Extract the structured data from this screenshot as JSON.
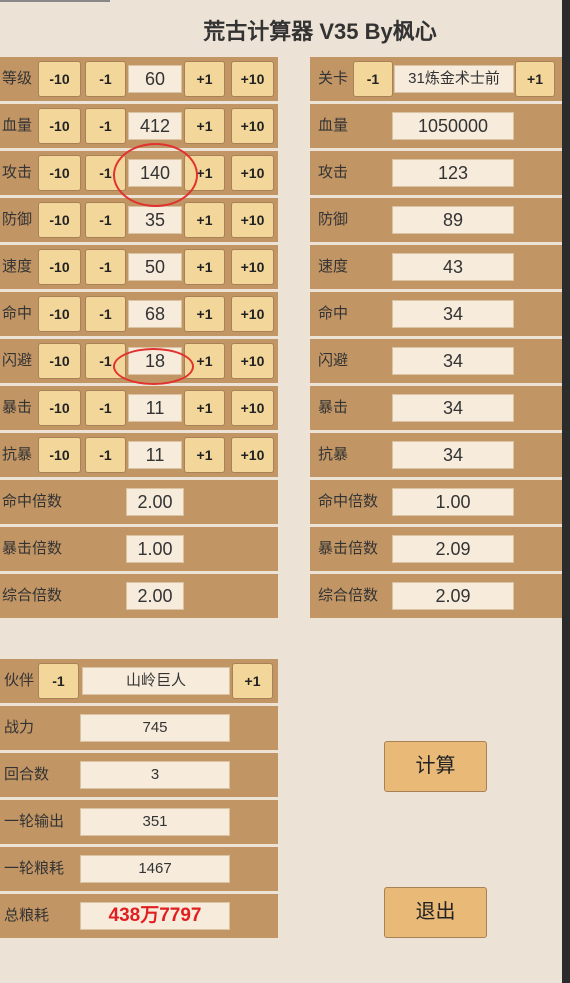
{
  "title": "荒古计算器  V35 By枫心",
  "player": {
    "rows": [
      {
        "label": "等级",
        "m10": "-10",
        "m1": "-1",
        "value": "60",
        "p1": "+1",
        "p10": "+10"
      },
      {
        "label": "血量",
        "m10": "-10",
        "m1": "-1",
        "value": "412",
        "p1": "+1",
        "p10": "+10"
      },
      {
        "label": "攻击",
        "m10": "-10",
        "m1": "-1",
        "value": "140",
        "p1": "+1",
        "p10": "+10"
      },
      {
        "label": "防御",
        "m10": "-10",
        "m1": "-1",
        "value": "35",
        "p1": "+1",
        "p10": "+10"
      },
      {
        "label": "速度",
        "m10": "-10",
        "m1": "-1",
        "value": "50",
        "p1": "+1",
        "p10": "+10"
      },
      {
        "label": "命中",
        "m10": "-10",
        "m1": "-1",
        "value": "68",
        "p1": "+1",
        "p10": "+10"
      },
      {
        "label": "闪避",
        "m10": "-10",
        "m1": "-1",
        "value": "18",
        "p1": "+1",
        "p10": "+10"
      },
      {
        "label": "暴击",
        "m10": "-10",
        "m1": "-1",
        "value": "11",
        "p1": "+1",
        "p10": "+10"
      },
      {
        "label": "抗暴",
        "m10": "-10",
        "m1": "-1",
        "value": "11",
        "p1": "+1",
        "p10": "+10"
      }
    ],
    "multipliers": [
      {
        "label": "命中倍数",
        "value": "2.00"
      },
      {
        "label": "暴击倍数",
        "value": "1.00"
      },
      {
        "label": "综合倍数",
        "value": "2.00"
      }
    ]
  },
  "enemy": {
    "stage": {
      "label": "关卡",
      "m1": "-1",
      "value": "31炼金术士前",
      "p1": "+1"
    },
    "rows": [
      {
        "label": "血量",
        "value": "1050000"
      },
      {
        "label": "攻击",
        "value": "123"
      },
      {
        "label": "防御",
        "value": "89"
      },
      {
        "label": "速度",
        "value": "43"
      },
      {
        "label": "命中",
        "value": "34"
      },
      {
        "label": "闪避",
        "value": "34"
      },
      {
        "label": "暴击",
        "value": "34"
      },
      {
        "label": "抗暴",
        "value": "34"
      },
      {
        "label": "命中倍数",
        "value": "1.00"
      },
      {
        "label": "暴击倍数",
        "value": "2.09"
      },
      {
        "label": "综合倍数",
        "value": "2.09"
      }
    ]
  },
  "partner": {
    "label": "伙伴",
    "m1": "-1",
    "name": "山岭巨人",
    "p1": "+1",
    "rows": [
      {
        "label": "战力",
        "value": "745"
      },
      {
        "label": "回合数",
        "value": "3"
      },
      {
        "label": "一轮输出",
        "value": "351"
      },
      {
        "label": "一轮粮耗",
        "value": "1467"
      },
      {
        "label": "总粮耗",
        "value": "438万7797"
      }
    ],
    "total_color": "#e02020"
  },
  "actions": {
    "calculate": "计算",
    "exit": "退出"
  },
  "colors": {
    "background": "#ece2d5",
    "row": "#c29565",
    "button": "#f3d79a",
    "field": "#f7ecdc",
    "highlight_circle": "#e0322f"
  }
}
